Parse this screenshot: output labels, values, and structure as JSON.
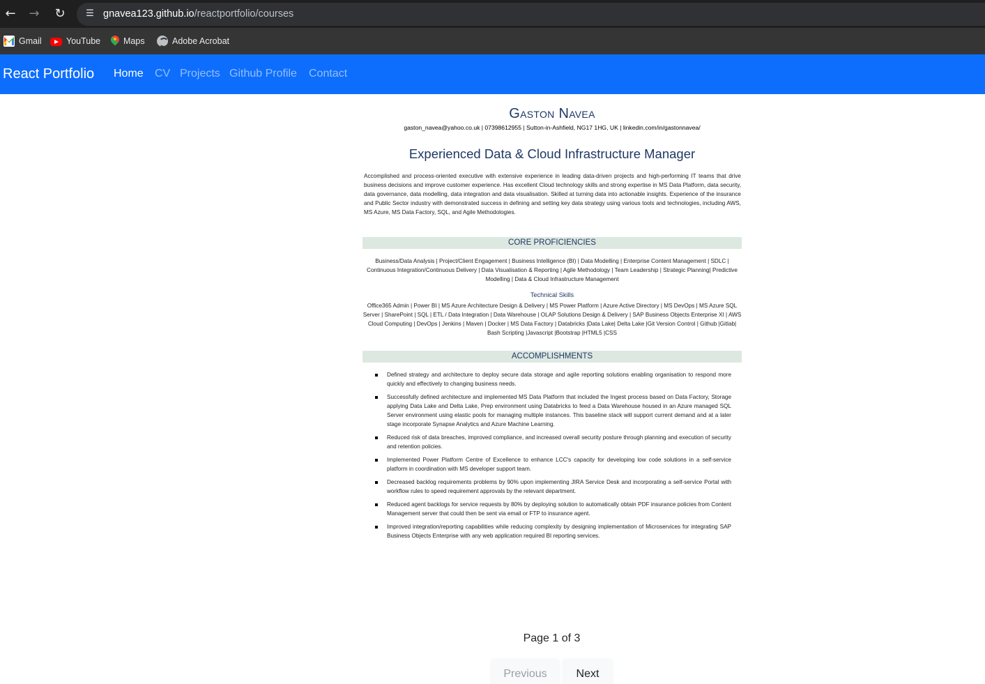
{
  "browser": {
    "url_host": "gnavea123.github.io",
    "url_path": "/reactportfolio/courses",
    "back_icon": "arrow-left",
    "forward_icon": "arrow-right",
    "reload_icon": "reload",
    "site_info_icon": "tune",
    "bookmarks": [
      {
        "label": "Gmail",
        "icon": "gmail-icon"
      },
      {
        "label": "YouTube",
        "icon": "youtube-icon"
      },
      {
        "label": "Maps",
        "icon": "maps-icon"
      },
      {
        "label": "Adobe Acrobat",
        "icon": "acrobat-icon"
      }
    ]
  },
  "navbar": {
    "brand": "React Portfolio",
    "links": [
      "Home",
      "CV",
      "Projects",
      "Github Profile",
      "Contact"
    ],
    "active_link": "Home",
    "bg_color": "#0d6efd"
  },
  "document": {
    "name": "Gaston Navea",
    "contact": "gaston_navea@yahoo.co.uk | 07398612955 | Sutton-in-Ashfield, NG17 1HG, UK | linkedin.com/in/gastonnavea/",
    "headline": "Experienced Data & Cloud Infrastructure Manager",
    "summary": "Accomplished and process-oriented executive with extensive experience in leading data-driven projects and high-performing IT teams that drive business decisions and improve customer experience. Has excellent Cloud technology skills and strong expertise in MS Data Platform, data security, data governance, data modelling, data integration and data visualisation. Skilled at turning data into actionable insights. Experience of the insurance and Public Sector industry with demonstrated success in defining and setting key data strategy using various tools and technologies, including AWS, MS Azure, MS Data Factory, SQL, and Agile Methodologies.",
    "core_title": "CORE PROFICIENCIES",
    "core_text": "Business/Data Analysis | Project/Client Engagement | Business Intelligence (BI) | Data Modelling | Enterprise Content Management | SDLC | Continuous Integration/Continuous Delivery | Data Visualisation & Reporting | Agile Methodology | Team Leadership | Strategic Planning| Predictive Modelling | Data & Cloud Infrastructure Management",
    "tech_title": "Technical Skills",
    "tech_text": "Office365 Admin | Power BI | MS Azure Architecture Design & Delivery | MS Power Platform | Azure Active Directory | MS DevOps | MS Azure SQL Server | SharePoint | SQL | ETL / Data Integration | Data Warehouse | OLAP Solutions Design & Delivery | SAP Business Objects Enterprise XI | AWS Cloud Computing | DevOps | Jenkins | Maven | Docker | MS Data Factory | Databricks |Data Lake| Delta Lake |Git Version Control | Github |Gitlab| Bash Scripting |Javascript |Bootstrap |HTML5 |CSS",
    "acc_title": "ACCOMPLISHMENTS",
    "accomplishments": [
      "Defined strategy and architecture to deploy secure data storage and agile reporting solutions enabling organisation to respond more quickly and effectively to changing business needs.",
      "Successfully defined architecture and implemented MS Data Platform that included the Ingest process based on Data Factory, Storage applying Data Lake and Delta Lake, Prep environment using Databricks to feed a Data Warehouse housed in an Azure managed SQL Server environment using elastic pools for managing multiple instances. This baseline stack will support current demand and at a later stage incorporate Synapse Analytics and Azure Machine Learning.",
      "Reduced risk of data breaches, improved compliance, and increased overall security posture through planning and execution of security and retention policies.",
      "Implemented Power Platform Centre of Excellence to enhance LCC's capacity for developing low code solutions in a self-service platform in coordination with MS developer support team.",
      "Decreased backlog requirements problems by 90% upon implementing JIRA Service Desk and incorporating a self-service Portal with workflow rules to speed requirement approvals by the relevant department.",
      "Reduced agent backlogs for service requests by 80% by deploying solution to automatically obtain PDF insurance policies from Content Management server that could then be sent via email or FTP to insurance agent.",
      "Improved integration/reporting capabilities while reducing complexity by designing implementation of Microservices for integrating SAP Business Objects Enterprise with any web application required BI reporting services."
    ],
    "section_bar_color": "#dde8e1",
    "heading_color": "#1f3864"
  },
  "pagination": {
    "indicator": "Page 1 of 3",
    "previous_label": "Previous",
    "next_label": "Next",
    "previous_disabled": true
  }
}
